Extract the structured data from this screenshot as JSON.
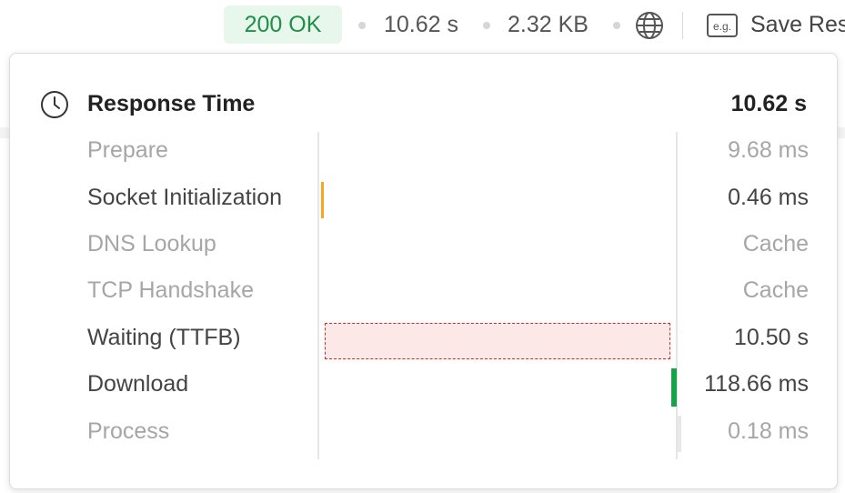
{
  "topbar": {
    "status": "200 OK",
    "time": "10.62 s",
    "size": "2.32 KB",
    "eg_icon_text": "e.g.",
    "save_label": "Save Res"
  },
  "popover": {
    "title": "Response Time",
    "total": "10.62 s",
    "phases": [
      {
        "label": "Prepare",
        "value": "9.68 ms",
        "state": "muted"
      },
      {
        "label": "Socket Initialization",
        "value": "0.46 ms",
        "state": "active"
      },
      {
        "label": "DNS Lookup",
        "value": "Cache",
        "state": "muted"
      },
      {
        "label": "TCP Handshake",
        "value": "Cache",
        "state": "muted"
      },
      {
        "label": "Waiting (TTFB)",
        "value": "10.50 s",
        "state": "active"
      },
      {
        "label": "Download",
        "value": "118.66 ms",
        "state": "active"
      },
      {
        "label": "Process",
        "value": "0.18 ms",
        "state": "muted"
      }
    ]
  },
  "colors": {
    "status_green": "#1f8f4a",
    "status_bg": "#e8f7ec",
    "socket_bar": "#f5a623",
    "ttfb_fill": "#fde8e8",
    "ttfb_border": "#e02424",
    "download_bar": "#16a34a"
  },
  "icons": {
    "globe": "globe-icon",
    "example": "example-icon",
    "clock": "clock-icon"
  }
}
